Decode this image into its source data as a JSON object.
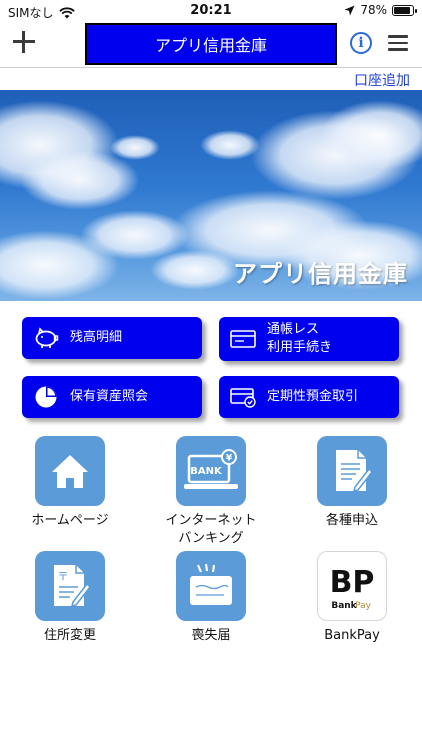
{
  "status": {
    "carrier": "SIMなし",
    "time": "20:21",
    "battery": "78%"
  },
  "nav": {
    "title": "アプリ信用金庫",
    "info_label": "i"
  },
  "add_account": "口座追加",
  "banner": {
    "text": "アプリ信用金庫"
  },
  "buttons": [
    {
      "line1": "残高明細",
      "line2": ""
    },
    {
      "line1": "通帳レス",
      "line2": "利用手続き"
    },
    {
      "line1": "保有資産照会",
      "line2": ""
    },
    {
      "line1": "定期性預金取引",
      "line2": ""
    }
  ],
  "tiles": [
    {
      "line1": "ホームページ",
      "line2": ""
    },
    {
      "line1": "インターネット",
      "line2": "バンキング",
      "icon_text": "BANK",
      "icon_badge": "¥"
    },
    {
      "line1": "各種申込",
      "line2": ""
    },
    {
      "line1": "住所変更",
      "line2": "",
      "icon_text": "〒"
    },
    {
      "line1": "喪失届",
      "line2": ""
    },
    {
      "line1": "BankPay",
      "line2": "",
      "logo_big": "BP",
      "logo_small": "Bank",
      "logo_small2": "Pay"
    }
  ],
  "colors": {
    "primary_blue": "#0000ee",
    "tile_blue": "#5a9bd8",
    "link_blue": "#1f3fd6"
  }
}
